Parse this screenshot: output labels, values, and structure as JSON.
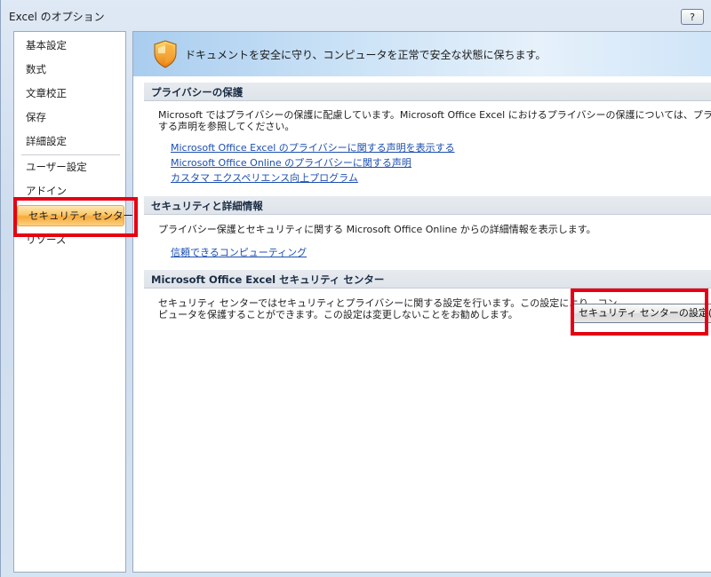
{
  "window": {
    "title": "Excel のオプション",
    "help_label": "?"
  },
  "sidebar": {
    "items": [
      {
        "label": "基本設定"
      },
      {
        "label": "数式"
      },
      {
        "label": "文章校正"
      },
      {
        "label": "保存"
      },
      {
        "label": "詳細設定"
      },
      {
        "label": "ユーザー設定"
      },
      {
        "label": "アドイン"
      },
      {
        "label": "セキュリティ センター",
        "selected": true
      },
      {
        "label": "リソース"
      }
    ]
  },
  "banner": {
    "icon": "shield-icon",
    "text": "ドキュメントを安全に守り、コンピュータを正常で安全な状態に保ちます。"
  },
  "privacy": {
    "heading": "プライバシーの保護",
    "desc_line1": "Microsoft ではプライバシーの保護に配慮しています。Microsoft Office Excel におけるプライバシーの保護については、プライバシーに関",
    "desc_line2": "する声明を参照してください。",
    "links": [
      "Microsoft Office Excel のプライバシーに関する声明を表示する",
      "Microsoft Office Online のプライバシーに関する声明",
      "カスタマ エクスペリエンス向上プログラム"
    ]
  },
  "security_info": {
    "heading": "セキュリティと詳細情報",
    "desc": "プライバシー保護とセキュリティに関する Microsoft Office Online からの詳細情報を表示します。",
    "link": "信頼できるコンピューティング"
  },
  "trust_center": {
    "heading": "Microsoft Office Excel セキュリティ センター",
    "desc_line1": "セキュリティ センターではセキュリティとプライバシーに関する設定を行います。この設定により、コン",
    "desc_line2": "ピュータを保護することができます。この設定は変更しないことをお勧めします。",
    "button_label": "セキュリティ センターの設定(T)..."
  },
  "colors": {
    "highlight": "#e60012",
    "selected_item": "#f7a93b",
    "link": "#1c4fb0"
  }
}
